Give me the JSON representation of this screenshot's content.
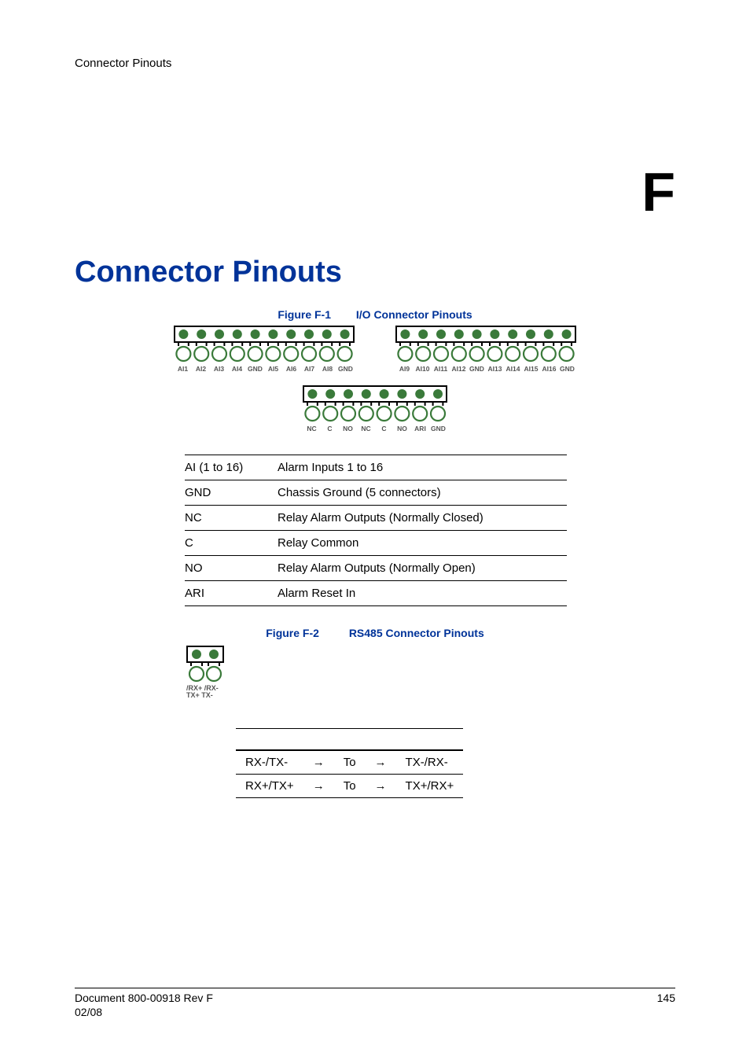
{
  "running_head": "Connector Pinouts",
  "appendix_letter": "F",
  "main_heading": "Connector Pinouts",
  "figure1": {
    "label": "Figure F-1",
    "title": "I/O Connector Pinouts",
    "block_a_labels": [
      "AI1",
      "AI2",
      "AI3",
      "AI4",
      "GND",
      "AI5",
      "AI6",
      "AI7",
      "AI8",
      "GND"
    ],
    "block_b_labels": [
      "AI9",
      "AI10",
      "AI11",
      "AI12",
      "GND",
      "AI13",
      "AI14",
      "AI15",
      "AI16",
      "GND"
    ],
    "block_c_labels": [
      "NC",
      "C",
      "NO",
      "NC",
      "C",
      "NO",
      "ARI",
      "GND"
    ]
  },
  "io_rows": [
    {
      "key": "AI (1 to 16)",
      "desc": "Alarm Inputs 1 to 16"
    },
    {
      "key": "GND",
      "desc": "Chassis Ground (5 connectors)"
    },
    {
      "key": "NC",
      "desc": "Relay Alarm Outputs (Normally Closed)"
    },
    {
      "key": "C",
      "desc": "Relay Common"
    },
    {
      "key": "NO",
      "desc": "Relay Alarm Outputs (Normally Open)"
    },
    {
      "key": "ARI",
      "desc": "Alarm Reset In"
    }
  ],
  "figure2": {
    "label": "Figure F-2",
    "title": "RS485 Connector Pinouts",
    "line1": "/RX+ /RX-",
    "line2": "TX+  TX-"
  },
  "rs_rows": [
    {
      "from": "RX-/TX-",
      "arrow1": "→",
      "mid": "To",
      "arrow2": "→",
      "to": "TX-/RX-"
    },
    {
      "from": "RX+/TX+",
      "arrow1": "→",
      "mid": "To",
      "arrow2": "→",
      "to": "TX+/RX+"
    }
  ],
  "footer": {
    "doc": "Document 800-00918 Rev F",
    "date": "02/08",
    "page": "145"
  }
}
